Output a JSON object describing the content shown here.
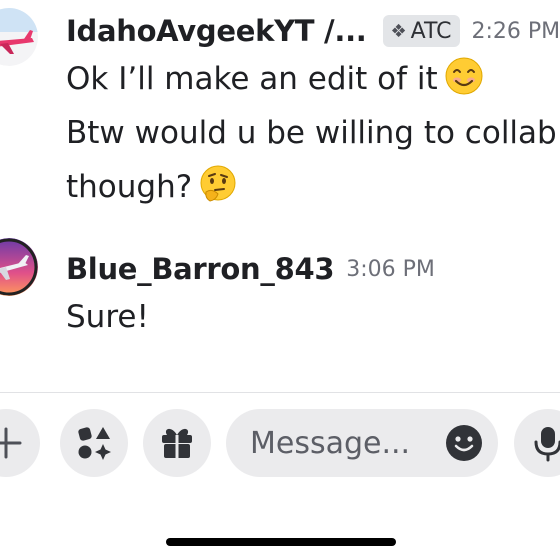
{
  "messages": [
    {
      "username": "IdahoAvgeekYT /...",
      "tag_icon": "diamond-wings-icon",
      "tag": "ATC",
      "timestamp": "2:26 PM",
      "lines": [
        "Ok I’ll make an edit of it",
        "Btw would u be willing to collab",
        "though?"
      ],
      "emojis": [
        "smiling-face-icon",
        "thinking-face-icon"
      ]
    },
    {
      "username": "Blue_Barron_843",
      "timestamp": "3:06 PM",
      "lines": [
        "Sure!"
      ]
    }
  ],
  "composer": {
    "placeholder": "Message...",
    "buttons": [
      "plus-icon",
      "apps-icon",
      "gift-icon",
      "emoji-icon",
      "microphone-icon"
    ]
  },
  "colors": {
    "input_bg": "#ebebed",
    "text": "#1f2024",
    "muted": "#6d6f78"
  }
}
